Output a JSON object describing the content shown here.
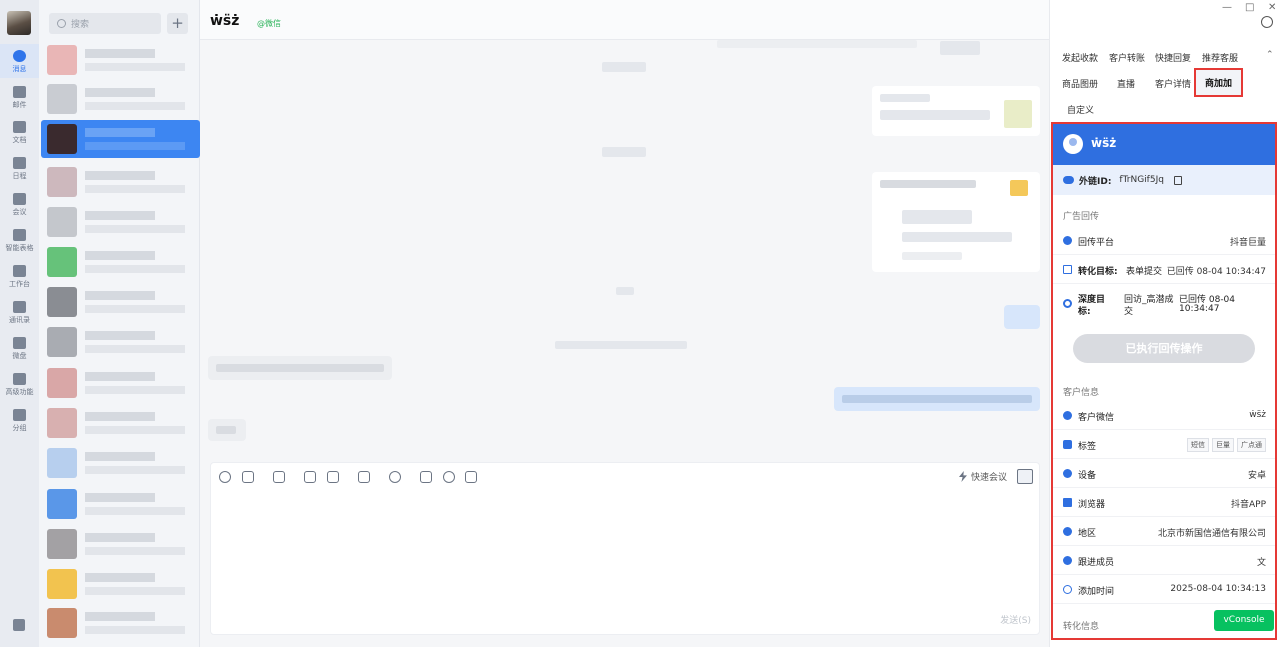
{
  "nav": {
    "items": [
      {
        "label": "消息",
        "icon": "chat-bubble-icon",
        "active": true
      },
      {
        "label": "邮件",
        "icon": "mail-icon"
      },
      {
        "label": "文档",
        "icon": "document-icon"
      },
      {
        "label": "日程",
        "icon": "calendar-icon"
      },
      {
        "label": "会议",
        "icon": "video-meeting-icon"
      },
      {
        "label": "智能表格",
        "icon": "smart-table-icon"
      },
      {
        "label": "工作台",
        "icon": "workbench-grid-icon"
      },
      {
        "label": "通讯录",
        "icon": "contacts-icon"
      },
      {
        "label": "微盘",
        "icon": "cloud-drive-icon"
      },
      {
        "label": "高级功能",
        "icon": "advanced-features-icon"
      },
      {
        "label": "分组",
        "icon": "group-icon"
      }
    ],
    "bottom_icon": "building-icon"
  },
  "convlist": {
    "search_placeholder": "搜索",
    "add_label": "+"
  },
  "chat": {
    "title": "ẇs̈ż",
    "channel_tag": "@微信",
    "quick_meeting": "快速会议",
    "send_label": "发送(S)"
  },
  "side": {
    "window_controls": {
      "minimize": "—",
      "maximize": "□",
      "close": "✕"
    },
    "tabs": [
      {
        "label": "发起收款"
      },
      {
        "label": "客户转账"
      },
      {
        "label": "快捷回复"
      },
      {
        "label": "推荐客服"
      },
      {
        "label": "商品图册"
      },
      {
        "label": "直播"
      },
      {
        "label": "客户详情"
      },
      {
        "label": "商加加",
        "active": true
      },
      {
        "label": "自定义"
      }
    ],
    "collapse_glyph": "⌃",
    "card": {
      "name": "ẇs̈ż",
      "id_label": "外链ID:",
      "id_value": "fTrNGif5Jq",
      "ad_section": "广告回传",
      "platform_label": "回传平台",
      "platform_value": "抖音巨量",
      "target_label": "转化目标:",
      "target_value": "表单提交",
      "target_status": "已回传 08-04 10:34:47",
      "deep_label_line1": "深度目",
      "deep_label_line2": "标:",
      "deep_value_line1": "回访_高潜成",
      "deep_value_line2": "交",
      "deep_status_line1": "已回传 08-04",
      "deep_status_line2": "10:34:47",
      "exec_button": "已执行回传操作",
      "customer_section": "客户信息",
      "rows": [
        {
          "label": "客户微信",
          "value": "ẇs̈ż",
          "icon": "wechat-icon"
        },
        {
          "label": "标签",
          "tags": [
            "短信",
            "巨量",
            "广点通"
          ],
          "icon": "tag-icon"
        },
        {
          "label": "设备",
          "value": "安卓",
          "icon": "apple-icon"
        },
        {
          "label": "浏览器",
          "value": "抖音APP",
          "icon": "code-icon"
        },
        {
          "label": "地区",
          "value": "北京市新国信通信有限公司",
          "icon": "location-pin-icon"
        },
        {
          "label": "跟进成员",
          "value": "文",
          "icon": "team-members-icon"
        },
        {
          "label": "添加时间",
          "value": "2025-08-04 10:34:13",
          "icon": "clock-icon"
        }
      ],
      "conversion_section": "转化信息"
    },
    "vconsole": "vConsole"
  },
  "colors": {
    "accent": "#2f6fe0",
    "highlight_border": "#e53935",
    "selected_conv": "#3d86f2",
    "vconsole": "#07c160"
  }
}
